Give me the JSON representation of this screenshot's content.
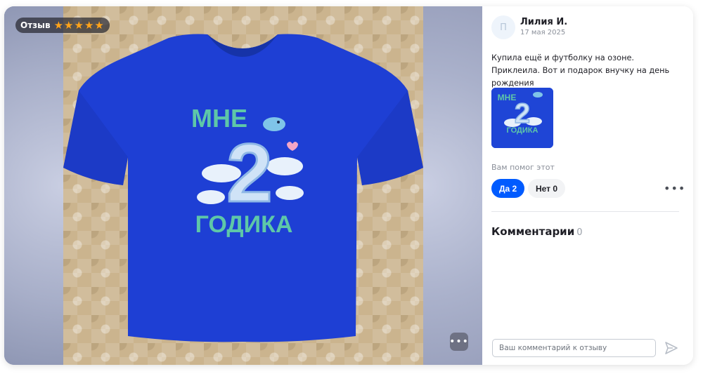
{
  "badge": {
    "label": "Отзыв",
    "rating": 5
  },
  "photo": {
    "print_top": "МНЕ",
    "print_number": "2",
    "print_bottom": "ГОДИКА",
    "shirt_color": "#1e3fd4",
    "fabric_color": "#cbb48e"
  },
  "review": {
    "avatar_letter": "П",
    "author": "Лилия И.",
    "date": "17 мая 2025",
    "text": "Купила ещё и футболку на озоне. Приклеила. Вот и подарок внучку на день рождения"
  },
  "helpful": {
    "question": "Вам помог этот",
    "yes_label": "Да 2",
    "no_label": "Нет 0"
  },
  "comments": {
    "title": "Комментарии",
    "count": "0",
    "input_placeholder": "Ваш комментарий к отзыву"
  },
  "colors": {
    "accent": "#005bff",
    "star": "#ffa31a"
  },
  "icons": {
    "more_photo": "more-horizontal-icon",
    "more_side": "more-horizontal-icon",
    "send": "send-icon",
    "star": "star-icon"
  }
}
